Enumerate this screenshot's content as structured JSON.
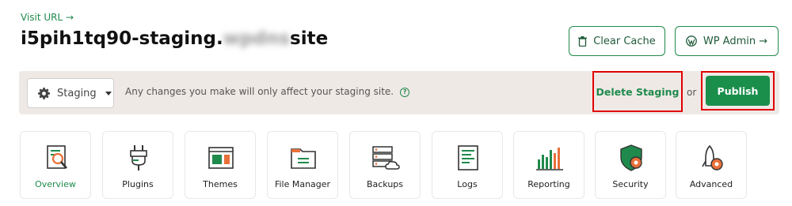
{
  "header": {
    "visit_url": "Visit URL →",
    "site_name_prefix": "i5pih1tq90-staging.",
    "site_name_hidden": "wpdns",
    "site_name_suffix": "site"
  },
  "actions": {
    "clear_cache": "Clear Cache",
    "wp_admin": "WP Admin →"
  },
  "staging_bar": {
    "environment": "Staging",
    "notice": "Any changes you make will only affect your staging site.",
    "delete_label": "Delete Staging",
    "or_label": "or",
    "publish_label": "Publish"
  },
  "tools": [
    {
      "label": "Overview",
      "icon": "overview-icon",
      "active": true
    },
    {
      "label": "Plugins",
      "icon": "plugin-icon"
    },
    {
      "label": "Themes",
      "icon": "themes-icon"
    },
    {
      "label": "File Manager",
      "icon": "folder-icon"
    },
    {
      "label": "Backups",
      "icon": "backups-icon"
    },
    {
      "label": "Logs",
      "icon": "logs-icon"
    },
    {
      "label": "Reporting",
      "icon": "reporting-icon"
    },
    {
      "label": "Security",
      "icon": "security-icon"
    },
    {
      "label": "Advanced",
      "icon": "advanced-icon"
    }
  ],
  "colors": {
    "accent": "#1f8a4c",
    "highlight": "#e00000",
    "orange": "#e8703a"
  }
}
